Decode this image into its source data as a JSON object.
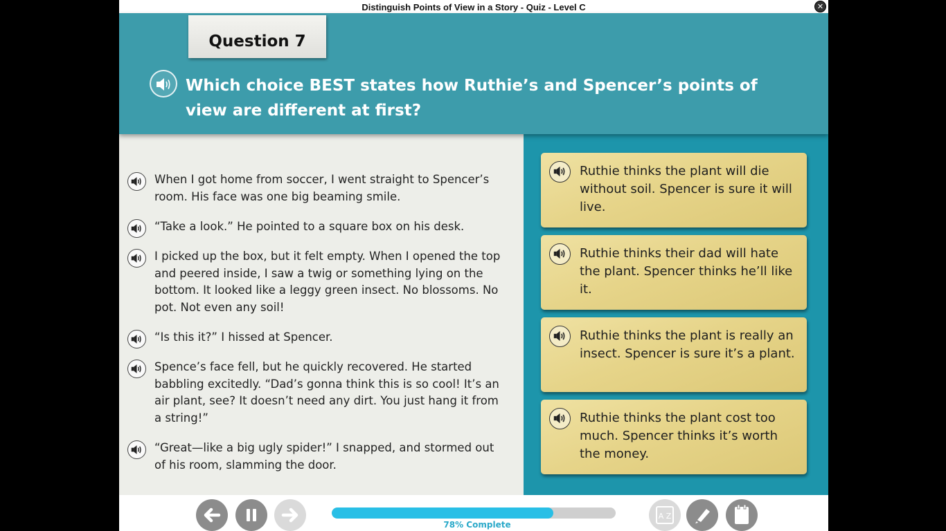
{
  "window": {
    "title": "Distinguish Points of View in a Story - Quiz - Level C",
    "close_symbol": "✕"
  },
  "question": {
    "label": "Question 7",
    "text": "Which choice BEST states how Ruthie’s and Spencer’s points of view are different at first?",
    "audio_icon": "speaker-icon"
  },
  "passage": {
    "paragraphs": [
      "When I got home from soccer, I went straight to Spencer’s room. His face was one big beaming smile.",
      "“Take a look.” He pointed to a square box on his desk.",
      "I picked up the box, but it felt empty. When I opened the top and peered inside, I saw a twig or something lying on the bottom. It looked like a leggy green insect. No blossoms. No pot. Not even any soil!",
      "“Is this it?” I hissed at Spencer.",
      "Spence’s face fell, but he quickly recovered. He started babbling excitedly. “Dad’s gonna think this is so cool! It’s an air plant, see? It doesn’t need any dirt. You just hang it from a string!”",
      "“Great—like a big ugly spider!” I snapped, and stormed out of his room, slamming the door."
    ]
  },
  "answers": [
    "Ruthie thinks the plant will die without soil. Spencer is sure it will live.",
    "Ruthie thinks their dad will hate the plant. Spencer thinks he’ll like it.",
    "Ruthie thinks the plant is really an insect. Spencer is sure it’s a plant.",
    "Ruthie thinks the plant cost too much. Spencer thinks it’s worth the money."
  ],
  "footer": {
    "progress_fraction": 0.78,
    "progress_text": "78% Complete",
    "glossary_glyph": "A Z",
    "buttons": [
      "back-arrow-icon",
      "pause-icon",
      "forward-arrow-icon",
      "glossary-icon",
      "highlighter-icon",
      "notepad-icon"
    ]
  },
  "colors": {
    "header": "#3d9cab",
    "answers_panel": "#1d95ab",
    "passage_bg": "#edeee9",
    "answer_card": "#e6d489",
    "progress": "#29bfe6"
  }
}
